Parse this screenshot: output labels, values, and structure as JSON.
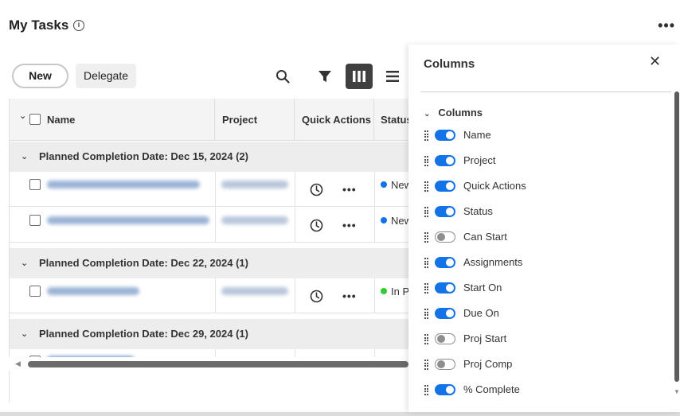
{
  "header": {
    "title": "My Tasks",
    "info_icon": "info-icon",
    "more_icon": "more-icon"
  },
  "toolbar": {
    "new_label": "New",
    "delegate_label": "Delegate",
    "icons": [
      "search-icon",
      "filter-icon",
      "columns-icon",
      "list-icon"
    ],
    "active_tool": "columns-icon"
  },
  "grid": {
    "columns": [
      "Name",
      "Project",
      "Quick Actions",
      "Status"
    ],
    "groups": [
      {
        "label": "Planned Completion Date: Dec 15, 2024 (2)",
        "rows": [
          {
            "status": "New",
            "status_color": "#1473e6"
          },
          {
            "status": "New",
            "status_color": "#1473e6"
          }
        ]
      },
      {
        "label": "Planned Completion Date: Dec 22, 2024 (1)",
        "rows": [
          {
            "status": "In P",
            "status_color": "#2ecc2e"
          }
        ]
      },
      {
        "label": "Planned Completion Date: Dec 29, 2024 (1)",
        "rows": []
      }
    ]
  },
  "colors": {
    "accent": "#1473e6",
    "toolbar_active": "#404040",
    "blurred_text": "#9bb3d6"
  },
  "panel": {
    "title": "Columns",
    "close_icon": "close-icon",
    "section_label": "Columns",
    "items": [
      {
        "label": "Name",
        "on": true
      },
      {
        "label": "Project",
        "on": true
      },
      {
        "label": "Quick Actions",
        "on": true
      },
      {
        "label": "Status",
        "on": true
      },
      {
        "label": "Can Start",
        "on": false
      },
      {
        "label": "Assignments",
        "on": true
      },
      {
        "label": "Start On",
        "on": true
      },
      {
        "label": "Due On",
        "on": true
      },
      {
        "label": "Proj Start",
        "on": false
      },
      {
        "label": "Proj Comp",
        "on": false
      },
      {
        "label": "% Complete",
        "on": true
      }
    ]
  }
}
